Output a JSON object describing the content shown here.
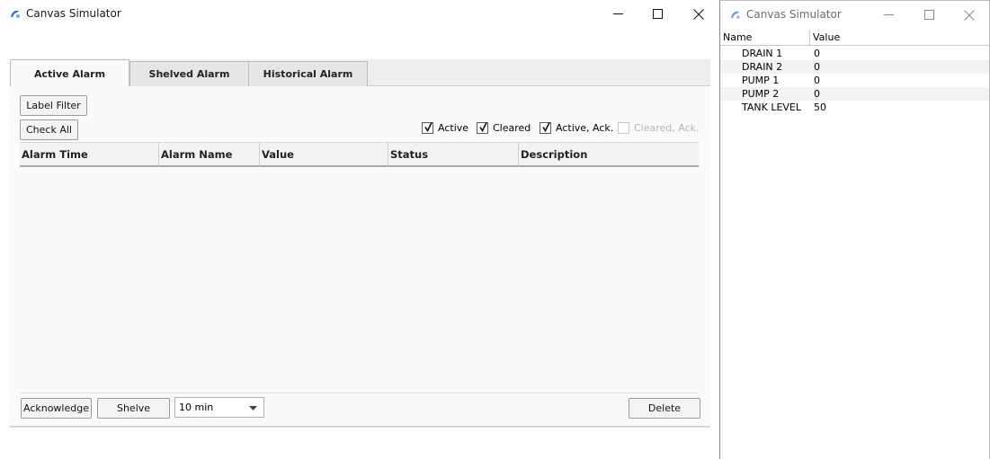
{
  "main_window": {
    "title": "Canvas Simulator",
    "tabs": [
      {
        "label": "Active Alarm",
        "active": true
      },
      {
        "label": "Shelved Alarm",
        "active": false
      },
      {
        "label": "Historical Alarm",
        "active": false
      }
    ],
    "toolbar": {
      "label_filter": "Label Filter",
      "check_all": "Check All"
    },
    "filters": [
      {
        "label": "Active",
        "checked": true,
        "enabled": true
      },
      {
        "label": "Cleared",
        "checked": true,
        "enabled": true
      },
      {
        "label": "Active, Ack.",
        "checked": true,
        "enabled": true
      },
      {
        "label": "Cleared, Ack.",
        "checked": false,
        "enabled": false
      }
    ],
    "table": {
      "columns": [
        "Alarm Time",
        "Alarm Name",
        "Value",
        "Status",
        "Description"
      ],
      "rows": []
    },
    "footer": {
      "acknowledge": "Acknowledge",
      "shelve": "Shelve",
      "shelve_duration": "10 min",
      "delete": "Delete"
    }
  },
  "side_window": {
    "title": "Canvas Simulator",
    "columns": {
      "name": "Name",
      "value": "Value"
    },
    "tags": [
      {
        "name": "DRAIN 1",
        "value": "0"
      },
      {
        "name": "DRAIN 2",
        "value": "0"
      },
      {
        "name": "PUMP 1",
        "value": "0"
      },
      {
        "name": "PUMP 2",
        "value": "0"
      },
      {
        "name": "TANK LEVEL",
        "value": "50"
      }
    ]
  },
  "icons": {
    "app": "canvas-simulator-icon",
    "minimize": "minimize-icon",
    "maximize": "maximize-icon",
    "close": "close-icon",
    "checkmark": "checkmark-icon",
    "dropdown": "chevron-down-icon"
  },
  "colors": {
    "tab_active_bg": "#fafafa",
    "tab_inactive_bg": "#e6e6e6",
    "disabled_text": "#b4b4b4",
    "app_icon": "#2f6fc4"
  }
}
